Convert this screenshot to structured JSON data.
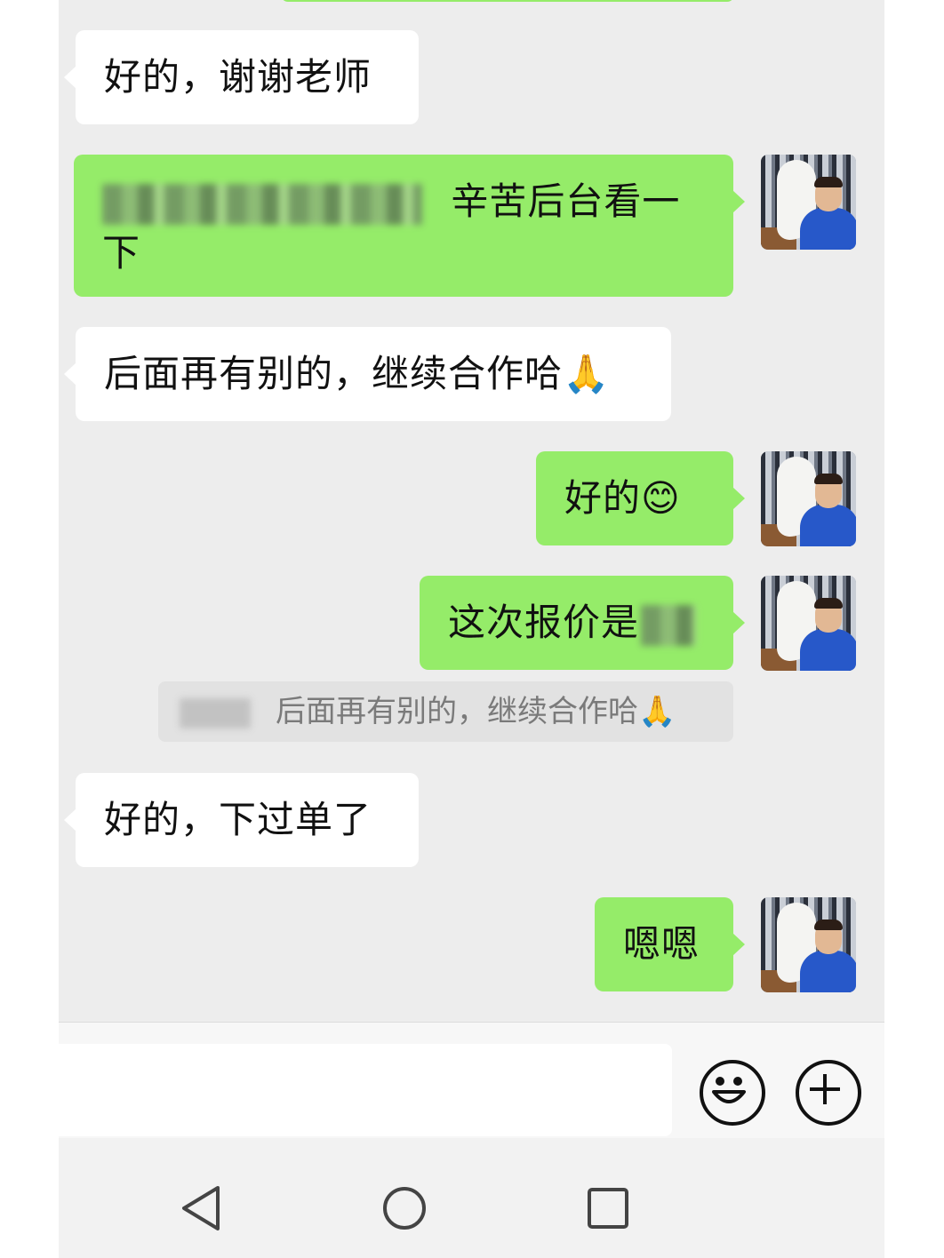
{
  "messages": [
    {
      "id": "m1",
      "side": "in",
      "text": "好的，谢谢老师"
    },
    {
      "id": "m2",
      "side": "out",
      "line1": "辛苦后台看一",
      "line2": "下",
      "redacted": true
    },
    {
      "id": "m3",
      "side": "in",
      "text": "后面再有别的，继续合作哈",
      "emoji": "pray-hands-emoji"
    },
    {
      "id": "m4",
      "side": "out",
      "text": "好的",
      "emoji": "smiling-face-emoji"
    },
    {
      "id": "m5",
      "side": "out",
      "text": "这次报价是",
      "redacted": true
    },
    {
      "id": "m6",
      "side": "in",
      "text": "好的，下过单了"
    },
    {
      "id": "m7",
      "side": "out",
      "text": "嗯嗯"
    }
  ],
  "quote": {
    "text": "后面再有别的，继续合作哈",
    "emoji": "pray-hands-emoji",
    "sender_redacted": true
  },
  "input_bar": {
    "placeholder": "",
    "emoji_button_icon": "smile-face-icon",
    "more_button_icon": "plus-circle-icon"
  },
  "nav_bar": {
    "back_icon": "triangle-back-icon",
    "home_icon": "circle-home-icon",
    "recent_icon": "square-recents-icon"
  },
  "colors": {
    "outgoing_bubble": "#95ec69",
    "incoming_bubble": "#ffffff",
    "chat_background": "#ededed",
    "quote_background": "#e2e2e2"
  }
}
